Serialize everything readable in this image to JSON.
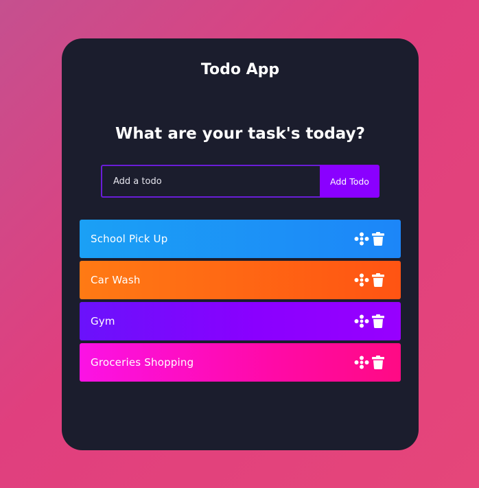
{
  "app": {
    "title": "Todo App",
    "heading": "What are your task's today?"
  },
  "form": {
    "placeholder": "Add a todo",
    "value": "",
    "add_label": "Add Todo"
  },
  "todos": [
    {
      "text": "School Pick Up",
      "color": "#1c8ff7",
      "edit_icon": "drag-dots-icon",
      "delete_icon": "trash-icon"
    },
    {
      "text": "Car Wash",
      "color": "#ff6514",
      "edit_icon": "drag-dots-icon",
      "delete_icon": "trash-icon"
    },
    {
      "text": "Gym",
      "color": "#8200ff",
      "edit_icon": "drag-dots-icon",
      "delete_icon": "trash-icon"
    },
    {
      "text": "Groceries Shopping",
      "color": "#ff0aa7",
      "edit_icon": "drag-dots-icon",
      "delete_icon": "trash-icon"
    }
  ],
  "colors": {
    "background_start": "#c5508f",
    "background_end": "#e5467a",
    "card": "#1b1d2d",
    "accent": "#8a00ff",
    "input_border": "#6a1dd8"
  }
}
